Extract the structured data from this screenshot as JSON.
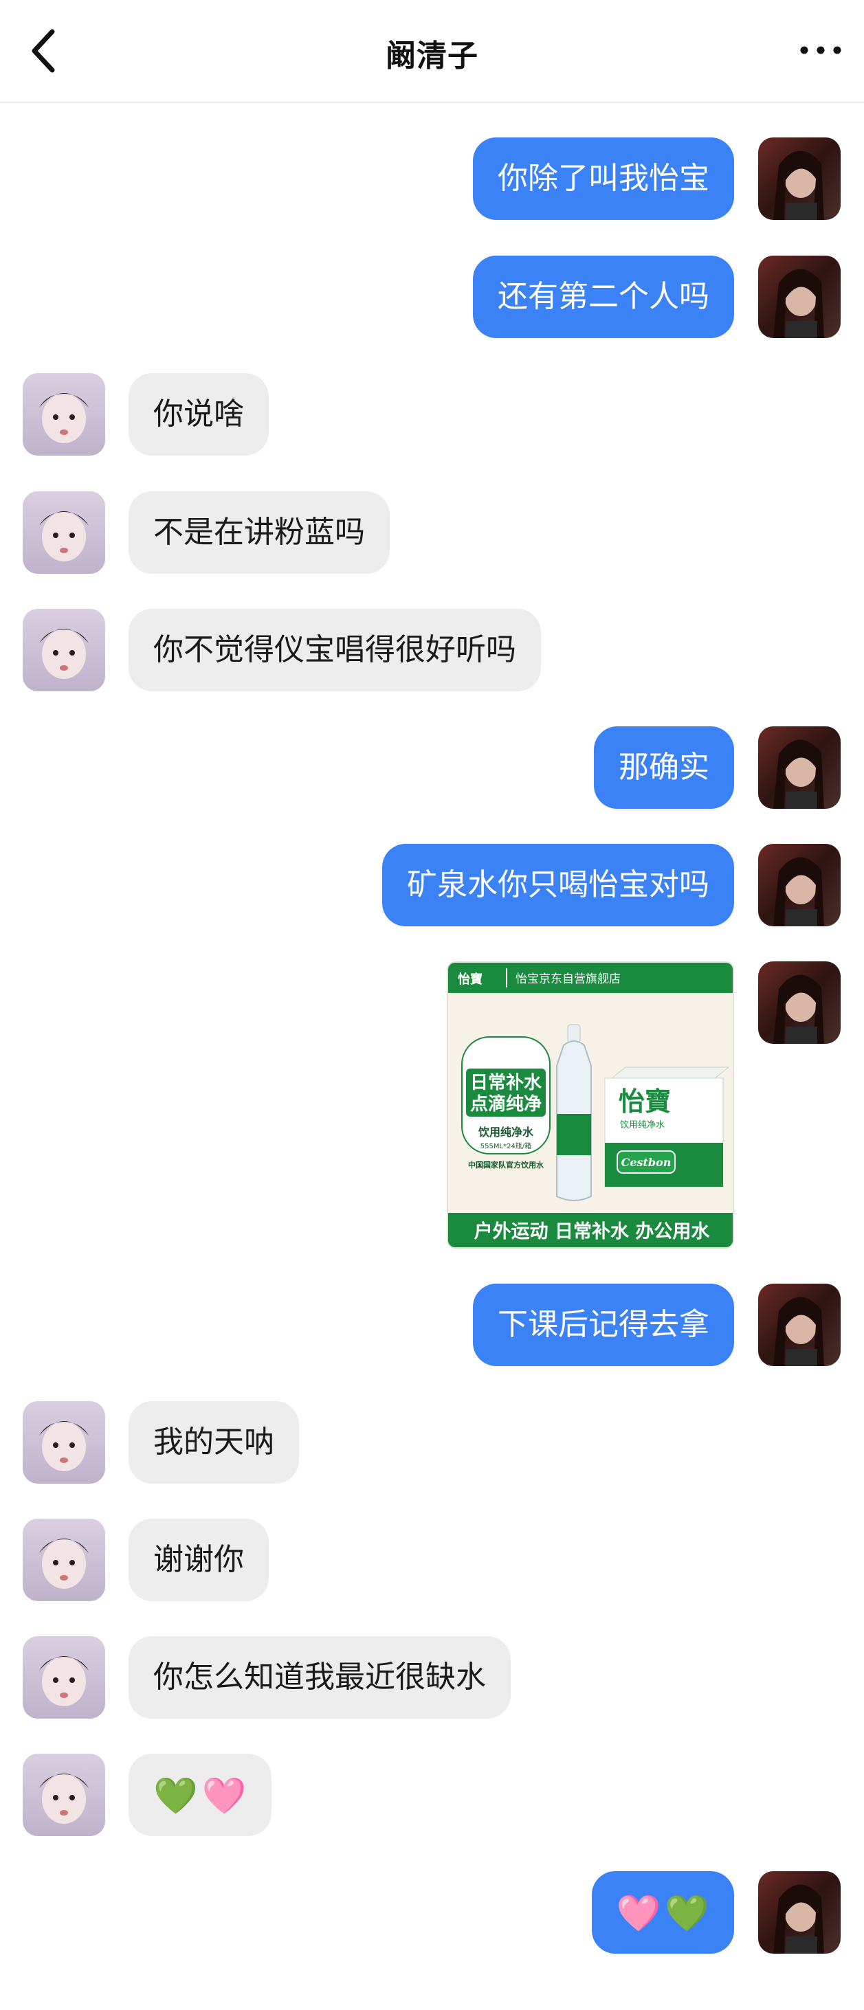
{
  "header": {
    "title": "阚清子",
    "back_icon": "chevron-left-icon",
    "more_icon": "more-horizontal-icon"
  },
  "colors": {
    "me_bubble": "#3b82f6",
    "them_bubble": "#ededed"
  },
  "messages": [
    {
      "from": "me",
      "text": "你除了叫我怡宝"
    },
    {
      "from": "me",
      "text": "还有第二个人吗"
    },
    {
      "from": "them",
      "text": "你说啥"
    },
    {
      "from": "them",
      "text": "不是在讲粉蓝吗"
    },
    {
      "from": "them",
      "text": "你不觉得仪宝唱得很好听吗"
    },
    {
      "from": "me",
      "text": "那确实"
    },
    {
      "from": "me",
      "text": "矿泉水你只喝怡宝对吗"
    },
    {
      "from": "me",
      "type": "image",
      "image": {
        "store": "怡宝京东自营旗舰店",
        "brand_badge": "怡寶",
        "slogan_line1": "日常补水",
        "slogan_line2": "点滴纯净",
        "product_label": "饮用纯净水",
        "spec": "555ML*24瓶/箱",
        "endorsement": "中国国家队官方饮用水",
        "box_brand": "怡寶",
        "box_sub": "饮用纯净水",
        "box_en": "Cestbon",
        "bottom_text": "户外运动 日常补水 办公用水"
      }
    },
    {
      "from": "me",
      "text": "下课后记得去拿"
    },
    {
      "from": "them",
      "text": "我的天呐"
    },
    {
      "from": "them",
      "text": "谢谢你"
    },
    {
      "from": "them",
      "text": "你怎么知道我最近很缺水"
    },
    {
      "from": "them",
      "emoji": [
        "💚",
        "🩷"
      ]
    },
    {
      "from": "me",
      "emoji": [
        "🩷",
        "💚"
      ]
    }
  ]
}
